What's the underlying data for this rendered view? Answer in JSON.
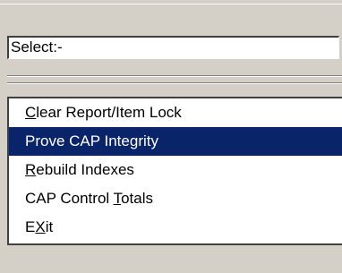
{
  "select_field": {
    "value": "Select:-"
  },
  "menu": {
    "items": [
      {
        "label": "Clear Report/Item Lock",
        "mnemonic": "C",
        "selected": false
      },
      {
        "label": "Prove CAP Integrity",
        "mnemonic": "",
        "selected": true
      },
      {
        "label": "Rebuild Indexes",
        "mnemonic": "R",
        "selected": false
      },
      {
        "label": "CAP Control Totals",
        "mnemonic": "T",
        "selected": false
      },
      {
        "label": "EXit",
        "mnemonic": "X",
        "selected": false
      }
    ]
  },
  "colors": {
    "background": "#d4d0c8",
    "selection": "#0a246a",
    "list_background": "#ffffff"
  }
}
